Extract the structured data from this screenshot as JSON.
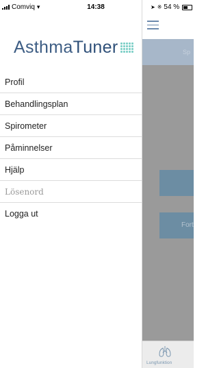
{
  "status_bar": {
    "carrier": "Comviq",
    "time": "14:38",
    "battery": "54 %"
  },
  "drawer": {
    "logo": {
      "part1": "Asthma",
      "part2": "Tuner"
    },
    "items": [
      {
        "label": "Profil"
      },
      {
        "label": "Behandlingsplan"
      },
      {
        "label": "Spirometer"
      },
      {
        "label": "Påminnelser"
      },
      {
        "label": "Hjälp"
      },
      {
        "label": "Lösenord"
      },
      {
        "label": "Logga ut"
      }
    ]
  },
  "background_app": {
    "header_text": "Sp",
    "button_b_text": "Fort",
    "tab_label": "Lungfunktion"
  },
  "colors": {
    "brand": "#3d5d84",
    "accent": "#7fd0c8",
    "header_band": "#a7b7c9",
    "button": "#6c8da3"
  }
}
